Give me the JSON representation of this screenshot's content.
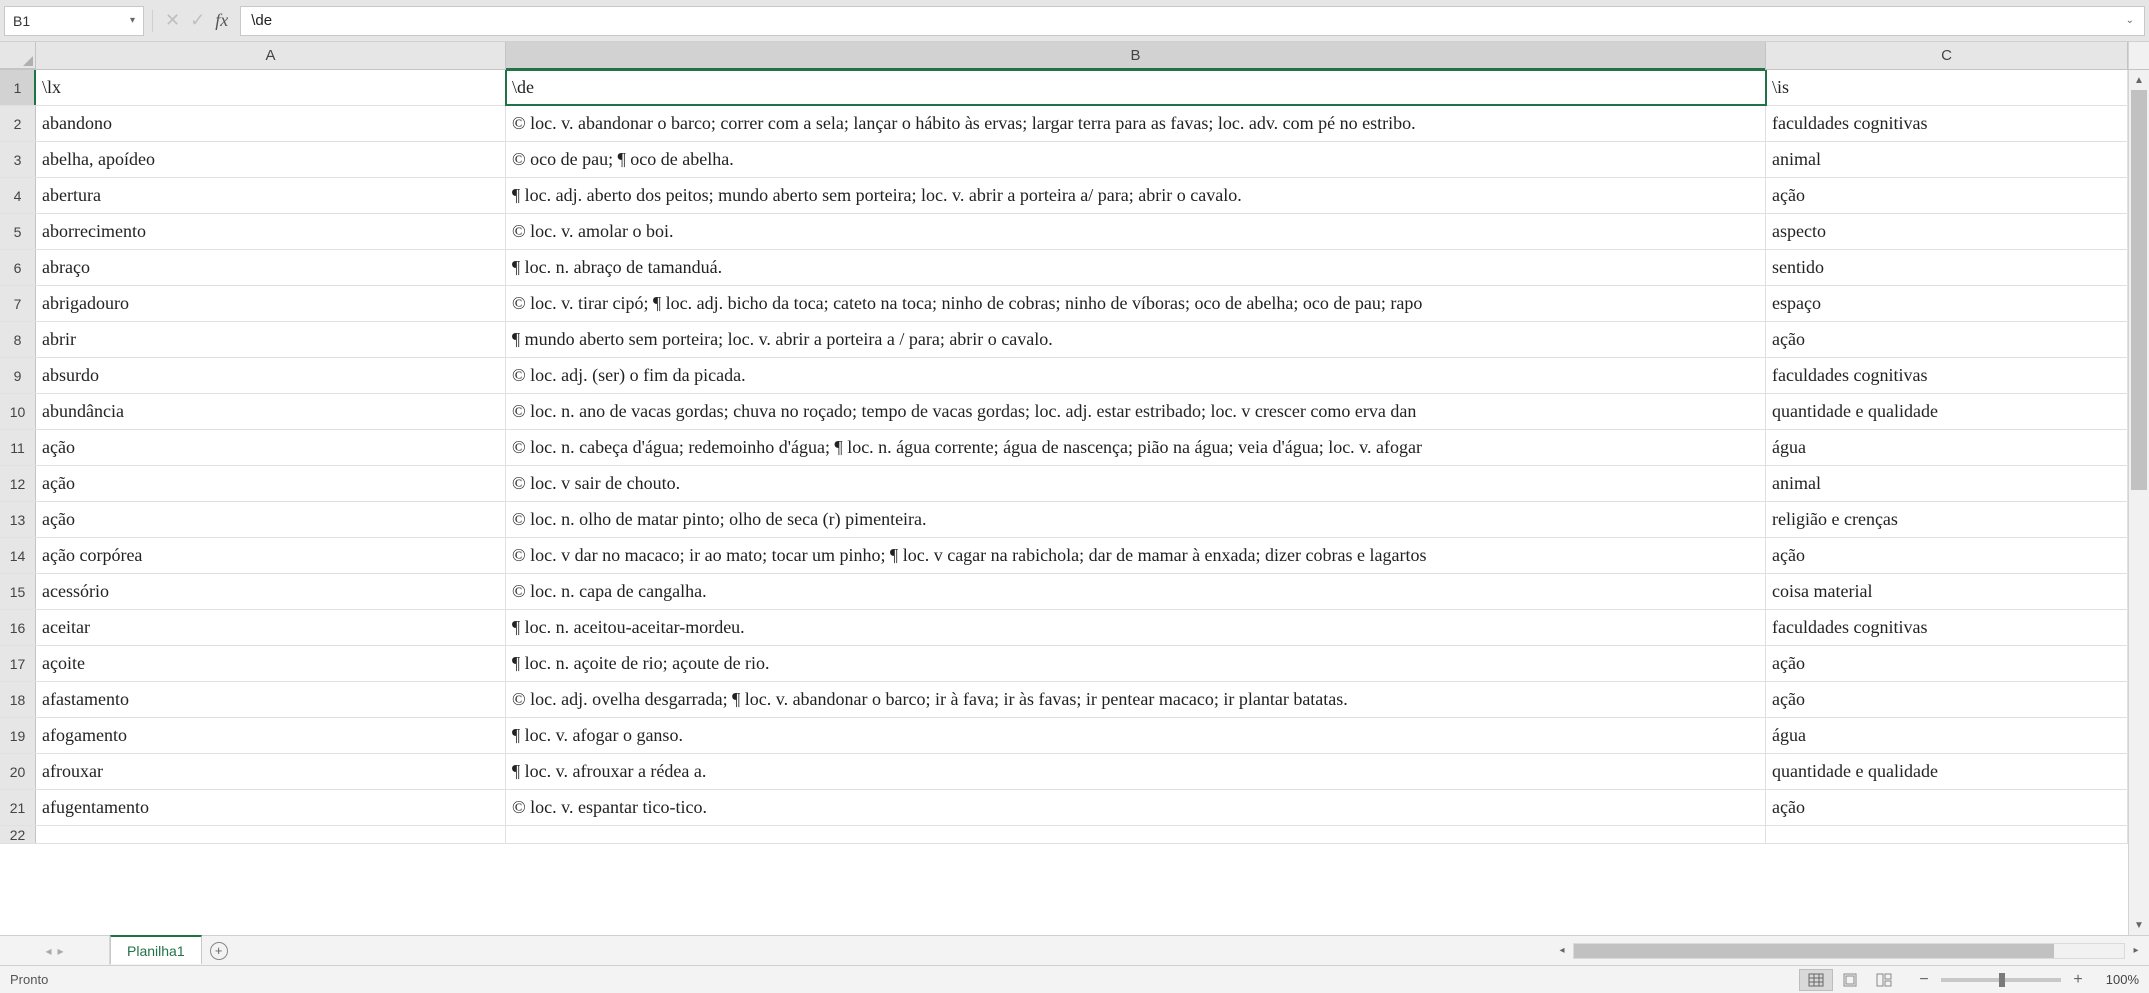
{
  "formula_bar": {
    "name_box": "B1",
    "formula": "\\de"
  },
  "columns": [
    "A",
    "B",
    "C"
  ],
  "active_cell": {
    "row": 1,
    "col": "B"
  },
  "rows": [
    {
      "n": 1,
      "a": "\\lx",
      "b": "\\de",
      "c": "\\is"
    },
    {
      "n": 2,
      "a": "abandono",
      "b": "© loc. v. abandonar o barco; correr com a sela;  lançar o hábito às ervas; largar terra para as favas; loc. adv. com pé no estribo.",
      "c": "faculdades cognitivas"
    },
    {
      "n": 3,
      "a": "abelha, apoídeo",
      "b": "©  oco de pau; ¶ oco de abelha.",
      "c": "animal"
    },
    {
      "n": 4,
      "a": "abertura",
      "b": "¶ loc. adj. aberto dos peitos; mundo aberto sem porteira; loc. v. abrir a porteira a/ para;  abrir o cavalo.",
      "c": "ação"
    },
    {
      "n": 5,
      "a": "aborrecimento",
      "b": "© loc. v. amolar o boi.",
      "c": "aspecto"
    },
    {
      "n": 6,
      "a": "abraço",
      "b": "¶ loc. n. abraço de tamanduá.",
      "c": "sentido"
    },
    {
      "n": 7,
      "a": "abrigadouro",
      "b": "© loc. v. tirar cipó; ¶ loc. adj. bicho da toca; cateto na toca; ninho de cobras; ninho de víboras; oco de abelha; oco de pau; rapo",
      "c": "espaço"
    },
    {
      "n": 8,
      "a": "abrir",
      "b": "¶ mundo aberto sem porteira; loc. v. abrir a porteira a / para; abrir o cavalo.",
      "c": "ação"
    },
    {
      "n": 9,
      "a": "absurdo",
      "b": "© loc. adj. (ser) o fim da picada.",
      "c": "faculdades cognitivas"
    },
    {
      "n": 10,
      "a": "abundância",
      "b": "© loc. n. ano de vacas gordas; chuva no roçado; tempo de vacas gordas; loc. adj. estar estribado; loc. v crescer como erva dan",
      "c": "quantidade e qualidade"
    },
    {
      "n": 11,
      "a": "ação",
      "b": "©  loc. n. cabeça d'água; redemoinho d'água; ¶ loc. n. água corrente; água de nascença; pião na água; veia d'água; loc. v. afogar",
      "c": "água"
    },
    {
      "n": 12,
      "a": "ação",
      "b": "© loc. v sair de chouto.",
      "c": "animal"
    },
    {
      "n": 13,
      "a": "ação",
      "b": "© loc. n. olho de matar pinto; olho de seca (r) pimenteira.",
      "c": "religião e crenças"
    },
    {
      "n": 14,
      "a": "ação corpórea",
      "b": "© loc. v dar no macaco; ir ao mato; tocar um pinho; ¶ loc. v cagar na rabichola; dar de mamar à enxada; dizer cobras e lagartos",
      "c": "ação"
    },
    {
      "n": 15,
      "a": "acessório",
      "b": "©  loc. n. capa de cangalha.",
      "c": "coisa material"
    },
    {
      "n": 16,
      "a": "aceitar",
      "b": "¶ loc. n. aceitou-aceitar-mordeu.",
      "c": "faculdades cognitivas"
    },
    {
      "n": 17,
      "a": "açoite",
      "b": "¶ loc. n. açoite de rio; açoute de rio.",
      "c": "ação"
    },
    {
      "n": 18,
      "a": "afastamento",
      "b": "© loc. adj. ovelha desgarrada; ¶ loc. v. abandonar o barco; ir à fava; ir às favas; ir pentear macaco; ir plantar batatas.",
      "c": "ação"
    },
    {
      "n": 19,
      "a": "afogamento",
      "b": "¶ loc. v. afogar o ganso.",
      "c": "água"
    },
    {
      "n": 20,
      "a": "afrouxar",
      "b": "¶ loc. v. afrouxar a rédea a.",
      "c": "quantidade e qualidade"
    },
    {
      "n": 21,
      "a": "afugentamento",
      "b": "© loc. v. espantar tico-tico.",
      "c": "ação"
    }
  ],
  "sheet_tabs": {
    "active": "Planilha1"
  },
  "status": {
    "text": "Pronto",
    "zoom": "100%"
  }
}
